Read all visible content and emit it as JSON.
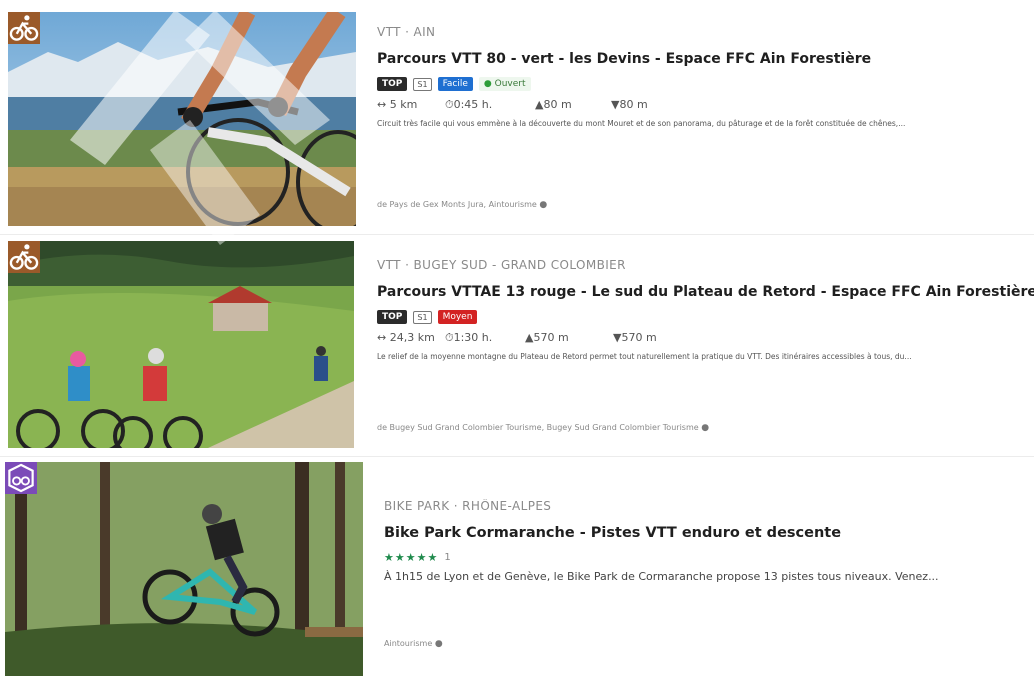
{
  "cards": [
    {
      "category_icon": "mountain-bike-icon",
      "badge_color": "#9a5a2a",
      "region": "VTT · AIN",
      "title": "Parcours VTT 80 - vert - les Devins - Espace FFC Ain Forestière",
      "tags": {
        "top": "TOP",
        "s1": "S1",
        "level": "Facile",
        "level_color": "#1f6fd1",
        "status": "Ouvert"
      },
      "stats": {
        "distance": "↔ 5 km",
        "duration": "0:45 h.",
        "ascent": "80 m",
        "descent": "80 m"
      },
      "description": "Circuit très facile qui vous emmène à la découverte du mont Mouret et de son panorama, du pâturage et de la forêt constituée de chênes,...",
      "source": "de Pays de Gex Monts Jura,  Aintourisme"
    },
    {
      "category_icon": "mountain-bike-icon",
      "badge_color": "#9a5a2a",
      "region": "VTT · BUGEY SUD - GRAND COLOMBIER",
      "title": "Parcours VTTAE 13 rouge - Le sud du Plateau de Retord - Espace FFC Ain Forestière",
      "tags": {
        "top": "TOP",
        "s1": "S1",
        "level": "Moyen",
        "level_color": "#d32323"
      },
      "stats": {
        "distance": "↔ 24,3 km",
        "duration": "1:30 h.",
        "ascent": "570 m",
        "descent": "570 m"
      },
      "description": "Le relief de la moyenne montagne du Plateau de Retord permet tout naturellement la pratique du VTT. Des itinéraires accessibles à tous, du...",
      "source": "de Bugey Sud Grand Colombier Tourisme,  Bugey Sud Grand Colombier Tourisme"
    },
    {
      "category_icon": "bike-park-icon",
      "badge_color": "#7b4bb8",
      "region": "BIKE PARK · RHÔNE-ALPES",
      "title": "Bike Park Cormaranche - Pistes VTT enduro et descente",
      "rating": {
        "stars": "★★★★★",
        "count": "1"
      },
      "description": "À 1h15 de Lyon et de Genève, le Bike Park de Cormaranche propose 13 pistes tous niveaux. Venez...",
      "source": "Aintourisme"
    }
  ],
  "photos": [
    "cyclist-lake-alps-photo",
    "two-cyclists-meadow-photo",
    "enduro-jump-forest-photo"
  ]
}
